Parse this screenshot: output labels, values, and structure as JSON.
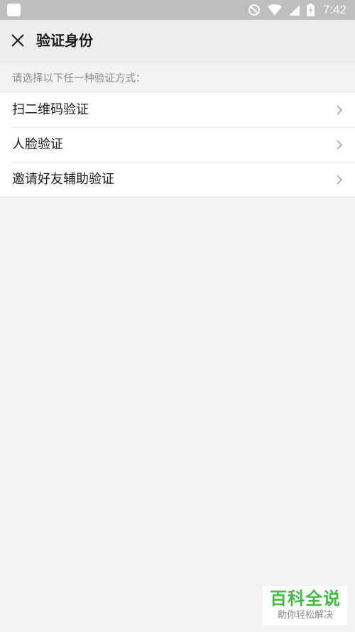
{
  "status_bar": {
    "time": "7:42",
    "icons": [
      "app-notification-icon",
      "do-not-disturb-icon",
      "wifi-icon",
      "signal-icon",
      "battery-charging-icon"
    ]
  },
  "header": {
    "title": "验证身份",
    "close_icon": "close-icon"
  },
  "hint": "请选择以下任一种验证方式：",
  "options": [
    {
      "label": "扫二维码验证",
      "icon": "chevron-right-icon"
    },
    {
      "label": "人脸验证",
      "icon": "chevron-right-icon"
    },
    {
      "label": "邀请好友辅助验证",
      "icon": "chevron-right-icon"
    }
  ],
  "watermark": {
    "title": "百科全说",
    "subtitle": "助你轻松解决"
  },
  "colors": {
    "status_bar": "#bdbdbd",
    "header_bg": "#ededed",
    "page_bg": "#f2f2f2",
    "watermark_green": "#3bbf3b"
  }
}
